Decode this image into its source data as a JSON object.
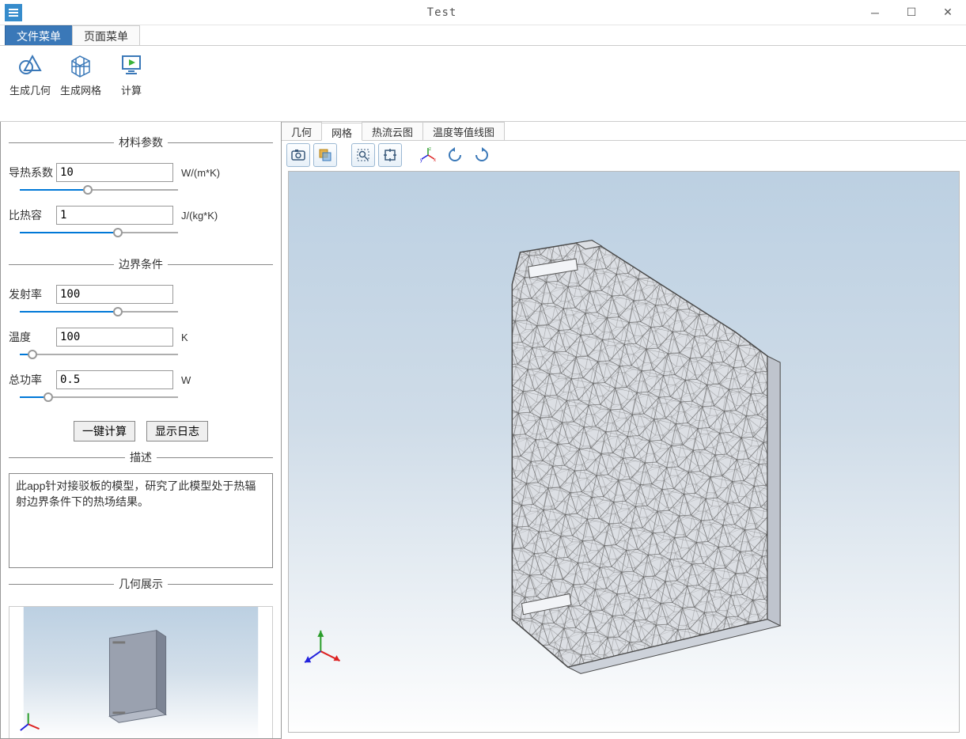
{
  "window": {
    "title": "Test"
  },
  "menu": {
    "tabs": [
      "文件菜单",
      "页面菜单"
    ],
    "active_index": 0
  },
  "ribbon": {
    "items": [
      {
        "label": "生成几何"
      },
      {
        "label": "生成网格"
      },
      {
        "label": "计算"
      }
    ]
  },
  "sidebar": {
    "sections": {
      "material": {
        "title": "材料参数",
        "params": {
          "conductivity": {
            "label": "导热系数",
            "value": "10",
            "unit": "W/(m*K)",
            "slider_pct": 43
          },
          "specific_heat": {
            "label": "比热容",
            "value": "1",
            "unit": "J/(kg*K)",
            "slider_pct": 62
          }
        }
      },
      "bc": {
        "title": "边界条件",
        "params": {
          "emissivity": {
            "label": "发射率",
            "value": "100",
            "unit": "",
            "slider_pct": 62
          },
          "temperature": {
            "label": "温度",
            "value": "100",
            "unit": "K",
            "slider_pct": 8
          },
          "total_power": {
            "label": "总功率",
            "value": "0.5",
            "unit": "W",
            "slider_pct": 18
          }
        }
      },
      "description": {
        "title": "描述",
        "text": "此app针对接驳板的模型，研究了此模型处于热辐射边界条件下的热场结果。"
      },
      "geom_preview": {
        "title": "几何展示"
      }
    },
    "buttons": {
      "compute": "一键计算",
      "show_log": "显示日志"
    }
  },
  "viewport": {
    "tabs": [
      "几何",
      "网格",
      "热流云图",
      "温度等值线图"
    ],
    "active_index": 1
  }
}
